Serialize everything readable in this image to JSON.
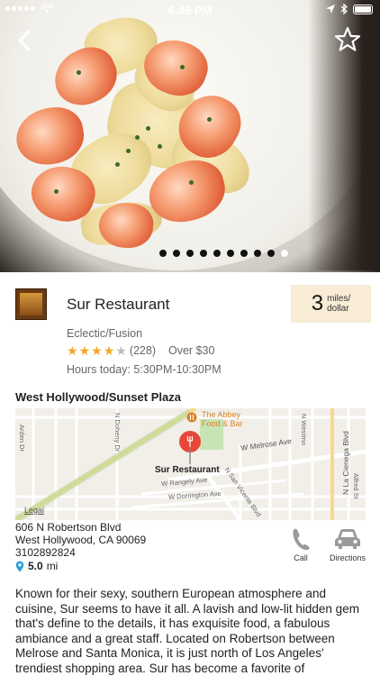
{
  "status_bar": {
    "time": "6:45 PM"
  },
  "hero": {
    "page_count": 10,
    "active_page": 10
  },
  "restaurant": {
    "name": "Sur Restaurant",
    "distance_value": "3",
    "distance_unit_line1": "miles/",
    "distance_unit_line2": "dollar",
    "cuisine": "Eclectic/Fusion",
    "rating": 4,
    "review_count": "(228)",
    "price": "Over $30",
    "hours": "Hours today: 5:30PM-10:30PM"
  },
  "area": {
    "title": "West Hollywood/Sunset Plaza"
  },
  "map": {
    "pin_label": "Sur Restaurant",
    "poi_label_line1": "The Abbey",
    "poi_label_line2": "Food & Bar",
    "legal": "Legal",
    "streets": {
      "arden": "Arden Dr",
      "doheny": "N Doheny Dr",
      "melrose": "W Melrose Ave",
      "rangely": "W Rangely Ave",
      "dorrington": "W Dorrington Ave",
      "san_vicente": "N San Vicente Blvd",
      "la_cienega": "N La Cienega Blvd",
      "westmount": "N Westmo",
      "alfred": "Alfred St"
    },
    "colors": {
      "park": "#c9e4b4",
      "poi": "#d9822b",
      "pin": "#e8473a",
      "road_major": "#f7d98b"
    }
  },
  "address": {
    "line1": "606 N Robertson Blvd",
    "line2": "West Hollywood, CA 90069",
    "phone": "3102892824",
    "distance_value": "5.0",
    "distance_unit": "mi"
  },
  "actions": {
    "call": "Call",
    "directions": "Directions"
  },
  "description": "Known for their sexy, southern European atmosphere and cuisine, Sur seems to have it all.  A lavish and low-lit hidden gem that's define to the details, it has exquisite food, a fabulous ambiance and a great staff.  Located on Robertson between Melrose and Santa Monica, it is just north of Los Angeles' trendiest shopping area.  Sur has become a favorite of",
  "icons": [
    "back-icon",
    "star-outline-icon",
    "location-pin-icon",
    "phone-icon",
    "car-icon"
  ]
}
